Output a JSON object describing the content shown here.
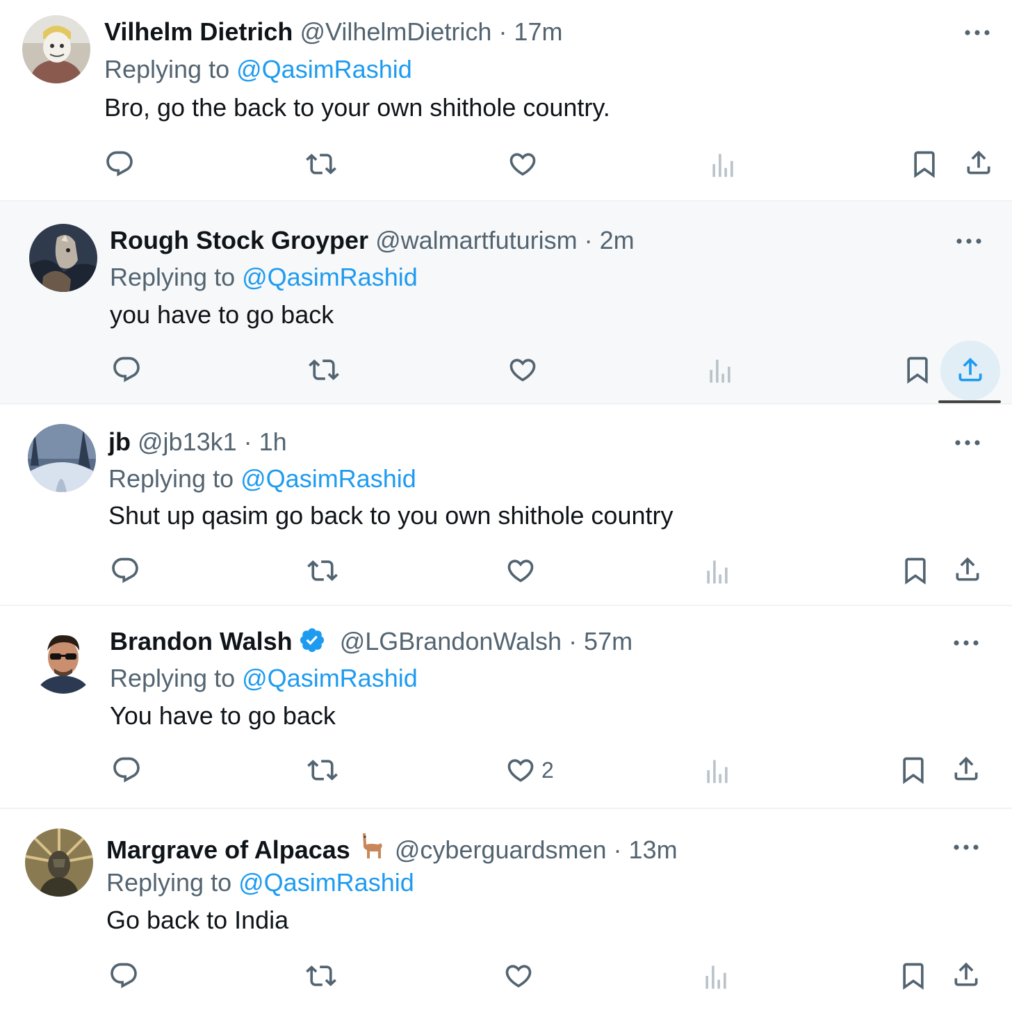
{
  "replying_label": "Replying to",
  "tweets": [
    {
      "name": "Vilhelm Dietrich",
      "handle": "@VilhelmDietrich",
      "time": "· 17m",
      "mention": "@QasimRashid",
      "text": "Bro, go the back to your own shithole country.",
      "like_count": "",
      "avatar": "cartoon-avatar"
    },
    {
      "name": "Rough Stock Groyper",
      "handle": "@walmartfuturism",
      "time": "· 2m",
      "mention": "@QasimRashid",
      "text": "you have to go back",
      "like_count": "",
      "avatar": "painting-avatar"
    },
    {
      "name": "jb",
      "handle": "@jb13k1",
      "time": "· 1h",
      "mention": "@QasimRashid",
      "text": "Shut up qasim go back to you own shithole country",
      "like_count": "",
      "avatar": "snow-forest-avatar"
    },
    {
      "name": "Brandon Walsh",
      "handle": "@LGBrandonWalsh",
      "time": "· 57m",
      "mention": "@QasimRashid",
      "text": "You have to go back",
      "like_count": "2",
      "avatar": "man-sunglasses-avatar",
      "verified": true
    },
    {
      "name": "Margrave of Alpacas",
      "handle": "@cyberguardsmen",
      "time": "· 13m",
      "mention": "@QasimRashid",
      "text": "Go back to India",
      "like_count": "",
      "avatar": "statue-avatar",
      "name_emoji": "llama-emoji"
    }
  ],
  "colors": {
    "text": "#0f1419",
    "secondary": "#536471",
    "link": "#1d9bf0",
    "highlight_bg": "#f7f8f9",
    "verified": "#1d9bf0"
  },
  "icons": [
    "reply-icon",
    "retweet-icon",
    "like-icon",
    "views-icon",
    "bookmark-icon",
    "share-icon",
    "more-icon"
  ]
}
